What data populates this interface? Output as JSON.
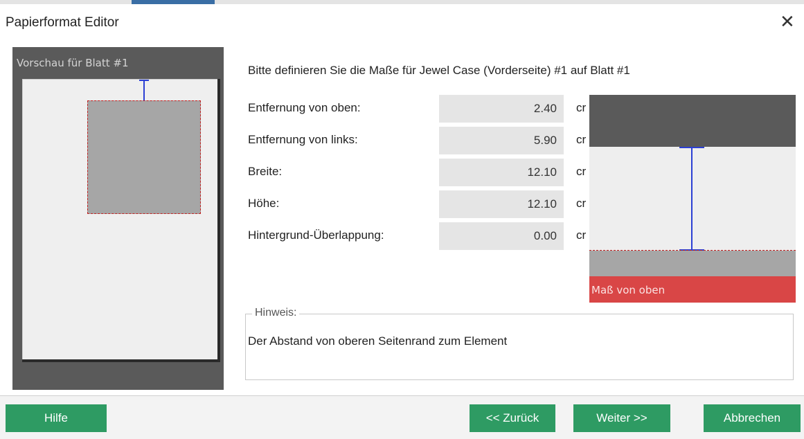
{
  "window": {
    "title": "Papierformat Editor",
    "close_glyph": "✕",
    "close_icon": "close-icon"
  },
  "preview": {
    "label": "Vorschau für Blatt #1"
  },
  "instruction": "Bitte definieren Sie die Maße für Jewel Case (Vorderseite) #1 auf Blatt #1",
  "fields": [
    {
      "label": "Entfernung von oben:",
      "value": "2.40",
      "unit": "cr"
    },
    {
      "label": "Entfernung von links:",
      "value": "5.90",
      "unit": "cr"
    },
    {
      "label": "Breite:",
      "value": "12.10",
      "unit": "cr"
    },
    {
      "label": "Höhe:",
      "value": "12.10",
      "unit": "cr"
    },
    {
      "label": "Hintergrund-Überlappung:",
      "value": "0.00",
      "unit": "cr"
    }
  ],
  "diagram": {
    "caption": "Maß von oben"
  },
  "hint": {
    "legend": "Hinweis:",
    "text": "Der Abstand von oberen Seitenrand zum Element"
  },
  "buttons": {
    "help": "Hilfe",
    "back": "<< Zurück",
    "next": "Weiter >>",
    "cancel": "Abbrechen"
  },
  "colors": {
    "accent_green": "#2e9b63",
    "marker_blue": "#2b3fd4",
    "marker_red": "#d94646",
    "dark_panel": "#5a5a5a"
  }
}
